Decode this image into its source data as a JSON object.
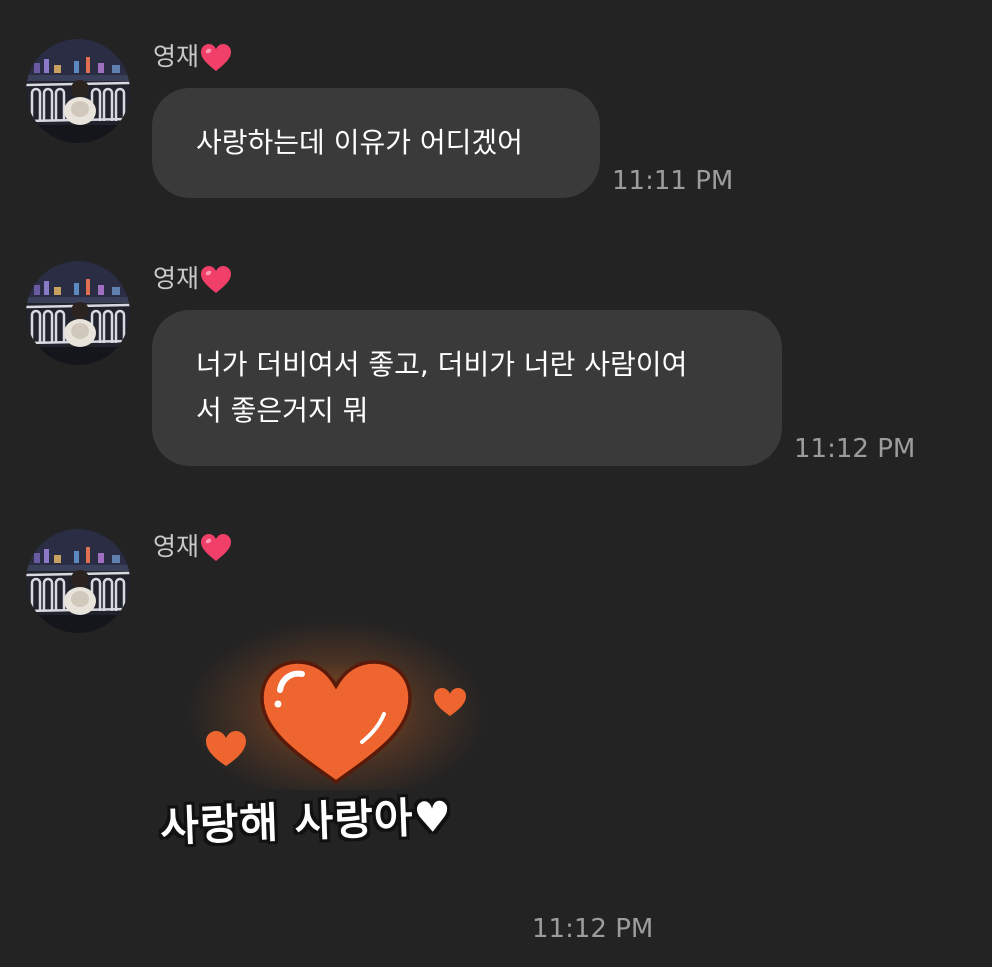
{
  "messages": [
    {
      "sender": "영재",
      "text": "사랑하는데 이유가 어디겠어",
      "time": "11:11 PM"
    },
    {
      "sender": "영재",
      "text_line1": "너가 더비여서 좋고, 더비가 너란 사람이여",
      "text_line2": "서 좋은거지 뭐",
      "time": "11:12 PM"
    },
    {
      "sender": "영재",
      "sticker_text": "사랑해 사랑아♥",
      "time": "11:12 PM"
    }
  ],
  "colors": {
    "background": "#232323",
    "bubble": "#3a3a3a",
    "heart_pink": "#f0406a",
    "sticker_heart": "#f0672e"
  },
  "icons": {
    "sender_suffix": "heart-icon",
    "sticker": "orange-heart-sticker"
  }
}
